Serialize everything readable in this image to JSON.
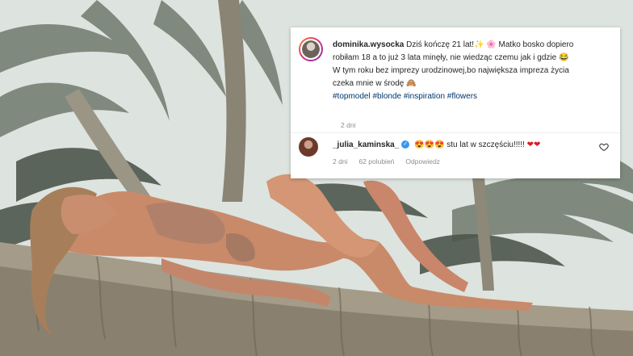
{
  "post": {
    "username": "dominika.wysocka",
    "caption_line1": "Dziś kończę 21 lat!✨ 🌸 Matko bosko dopiero",
    "caption_line2": "robiłam 18 a to już 3 lata minęły, nie wiedząc czemu jak i gdzie 😂",
    "caption_line3": "W tym roku bez imprezy urodzinowej,bo największa impreza życia",
    "caption_line4": "czeka mnie w środę 🙈",
    "hashtags": [
      "#topmodel",
      "#blonde",
      "#inspiration",
      "#flowers"
    ],
    "time": "2 dni"
  },
  "comment": {
    "username": "_julia_kaminska_",
    "text": "😍😍😍 stu lat w szczęściu!!!!! ",
    "hearts": "❤❤",
    "time": "2 dni",
    "likes": "62 polubień",
    "reply": "Odpowiedz"
  },
  "icons": {
    "verified": "verified-badge-icon",
    "like": "heart-outline-icon"
  },
  "colors": {
    "hashtag": "#00376b",
    "meta": "#8e8e8e",
    "verified": "#3897f0",
    "heart": "#d3202a"
  }
}
